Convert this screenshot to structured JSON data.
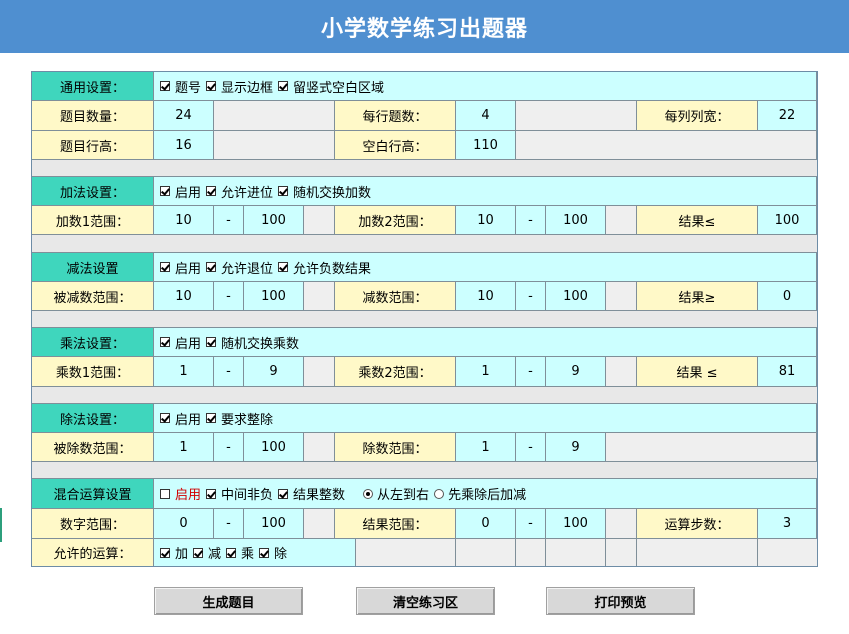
{
  "title": "小学数学练习出题器",
  "general": {
    "label": "通用设置：",
    "options": [
      {
        "label": "题号",
        "checked": true
      },
      {
        "label": "显示边框",
        "checked": true
      },
      {
        "label": "留竖式空白区域",
        "checked": true
      }
    ],
    "count_label": "题目数量：",
    "count": "24",
    "per_row_label": "每行题数：",
    "per_row": "4",
    "col_width_label": "每列列宽：",
    "col_width": "22",
    "row_height_label": "题目行高：",
    "row_height": "16",
    "blank_height_label": "空白行高：",
    "blank_height": "110"
  },
  "addition": {
    "label": "加法设置：",
    "options": [
      {
        "label": "启用",
        "checked": true
      },
      {
        "label": "允许进位",
        "checked": true
      },
      {
        "label": "随机交换加数",
        "checked": true
      }
    ],
    "a_label": "加数1范围：",
    "a_min": "10",
    "a_max": "100",
    "b_label": "加数2范围：",
    "b_min": "10",
    "b_max": "100",
    "result_label": "结果≤",
    "result": "100"
  },
  "subtraction": {
    "label": "减法设置",
    "options": [
      {
        "label": "启用",
        "checked": true
      },
      {
        "label": "允许退位",
        "checked": true
      },
      {
        "label": "允许负数结果",
        "checked": true
      }
    ],
    "a_label": "被减数范围：",
    "a_min": "10",
    "a_max": "100",
    "b_label": "减数范围：",
    "b_min": "10",
    "b_max": "100",
    "result_label": "结果≥",
    "result": "0"
  },
  "multiplication": {
    "label": "乘法设置：",
    "options": [
      {
        "label": "启用",
        "checked": true
      },
      {
        "label": "随机交换乘数",
        "checked": true
      }
    ],
    "a_label": "乘数1范围：",
    "a_min": "1",
    "a_max": "9",
    "b_label": "乘数2范围：",
    "b_min": "1",
    "b_max": "9",
    "result_label": "结果 ≤",
    "result": "81"
  },
  "division": {
    "label": "除法设置：",
    "options": [
      {
        "label": "启用",
        "checked": true
      },
      {
        "label": "要求整除",
        "checked": true
      }
    ],
    "a_label": "被除数范围：",
    "a_min": "1",
    "a_max": "100",
    "b_label": "除数范围：",
    "b_min": "1",
    "b_max": "9"
  },
  "mixed": {
    "label": "混合运算设置",
    "enable_label": "启用",
    "enable_checked": false,
    "options": [
      {
        "label": "中间非负",
        "checked": true
      },
      {
        "label": "结果整数",
        "checked": true
      }
    ],
    "order": [
      {
        "label": "从左到右",
        "selected": true
      },
      {
        "label": "先乘除后加减",
        "selected": false
      }
    ],
    "num_label": "数字范围：",
    "num_min": "0",
    "num_max": "100",
    "res_label": "结果范围：",
    "res_min": "0",
    "res_max": "100",
    "steps_label": "运算步数：",
    "steps": "3",
    "ops_label": "允许的运算：",
    "ops": [
      {
        "label": "加",
        "checked": true
      },
      {
        "label": "减",
        "checked": true
      },
      {
        "label": "乘",
        "checked": true
      },
      {
        "label": "除",
        "checked": true
      }
    ]
  },
  "dash": "-",
  "buttons": {
    "generate": "生成题目",
    "clear": "清空练习区",
    "print": "打印预览"
  },
  "colors": {
    "title_bar": "#4f8fd0",
    "section_header": "#3fd6bd",
    "label_cell": "#fff9c8",
    "value_cell": "#ccffff",
    "disabled_enable_text": "#d00000"
  }
}
